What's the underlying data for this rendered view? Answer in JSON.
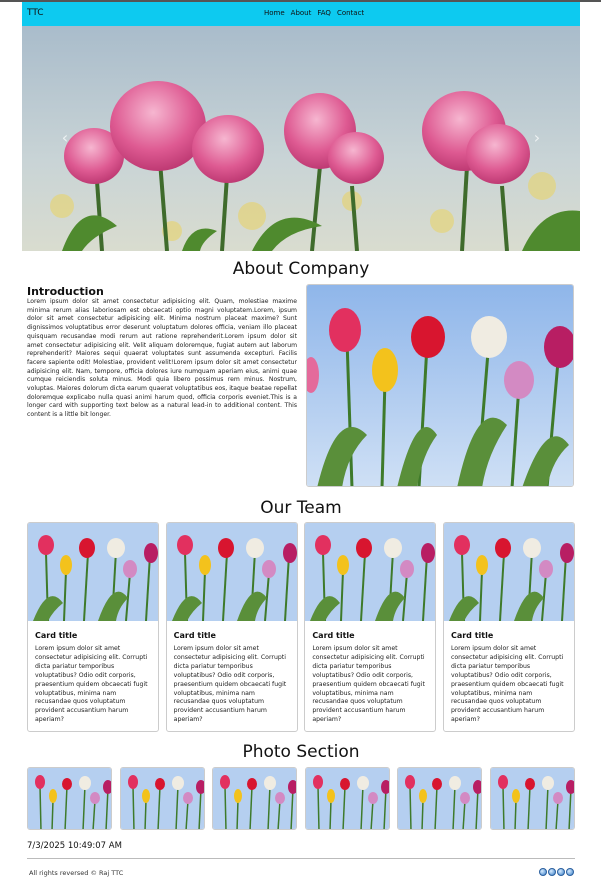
{
  "nav": {
    "brand": "TTC",
    "links": [
      "Home",
      "About",
      "FAQ",
      "Contact"
    ]
  },
  "hero": {
    "prev_icon": "chevron-left-icon",
    "next_icon": "chevron-right-icon"
  },
  "about": {
    "heading": "About Company",
    "intro_title": "Introduction",
    "intro_text": "Lorem ipsum dolor sit amet consectetur adipisicing elit. Quam, molestiae maxime minima rerum alias laboriosam est obcaecati optio magni voluptatem.Lorem, ipsum dolor sit amet consectetur adipisicing elit. Minima nostrum placeat maxime? Sunt dignissimos voluptatibus error deserunt voluptatum dolores officia, veniam illo placeat quisquam recusandae modi rerum aut ratione reprehenderit.Lorem ipsum dolor sit amet consectetur adipisicing elit. Velit aliquam doloremque, fugiat autem aut laborum reprehenderit? Maiores sequi quaerat voluptates sunt assumenda excepturi. Facilis facere sapiente odit! Molestiae, provident velit!Lorem ipsum dolor sit amet consectetur adipisicing elit. Nam, tempore, officia dolores iure numquam aperiam eius, animi quae cumque reiciendis soluta minus. Modi quia libero possimus rem minus. Nostrum, voluptas. Maiores dolorum dicta earum quaerat voluptatibus eos, itaque beatae repellat doloremque explicabo nulla quasi animi harum quod, officia corporis eveniet.This is a longer card with supporting text below as a natural lead-in to additional content. This content is a little bit longer."
  },
  "team": {
    "heading": "Our Team",
    "cards": [
      {
        "title": "Card title",
        "text": "Lorem ipsum dolor sit amet consectetur adipisicing elit. Corrupti dicta pariatur temporibus voluptatibus? Odio odit corporis, praesentium quidem obcaecati fugit voluptatibus, minima nam recusandae quos voluptatum provident accusantium harum aperiam?"
      },
      {
        "title": "Card title",
        "text": "Lorem ipsum dolor sit amet consectetur adipisicing elit. Corrupti dicta pariatur temporibus voluptatibus? Odio odit corporis, praesentium quidem obcaecati fugit voluptatibus, minima nam recusandae quos voluptatum provident accusantium harum aperiam?"
      },
      {
        "title": "Card title",
        "text": "Lorem ipsum dolor sit amet consectetur adipisicing elit. Corrupti dicta pariatur temporibus voluptatibus? Odio odit corporis, praesentium quidem obcaecati fugit voluptatibus, minima nam recusandae quos voluptatum provident accusantium harum aperiam?"
      },
      {
        "title": "Card title",
        "text": "Lorem ipsum dolor sit amet consectetur adipisicing elit. Corrupti dicta pariatur temporibus voluptatibus? Odio odit corporis, praesentium quidem obcaecati fugit voluptatibus, minima nam recusandae quos voluptatum provident accusantium harum aperiam?"
      }
    ]
  },
  "photos": {
    "heading": "Photo Section",
    "count": 6
  },
  "datetime": "7/3/2025  10:49:07 AM",
  "footer": {
    "text": "All rights reversed © Raj TTC",
    "social_icons": [
      "social-icon",
      "social-icon",
      "social-icon",
      "social-icon"
    ]
  },
  "colors": {
    "navbar": "#0dcaf0",
    "card_border": "#cccccc"
  }
}
